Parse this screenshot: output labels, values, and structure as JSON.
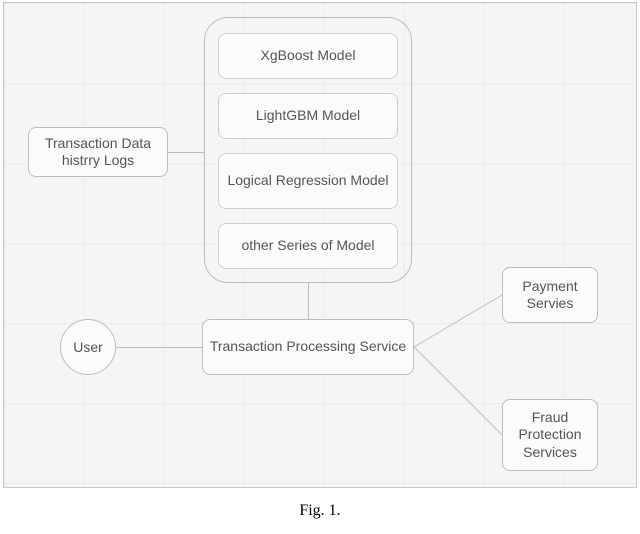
{
  "caption": "Fig. 1.",
  "nodes": {
    "transaction_data": "Transaction Data histrry Logs",
    "user": "User",
    "models": {
      "m1": "XgBoost Model",
      "m2": "LightGBM Model",
      "m3": "Logical Regression Model",
      "m4": "other Series of Model"
    },
    "tps": "Transaction Processing Service",
    "payment": "Payment Servies",
    "fraud": "Fraud Protection Services"
  }
}
